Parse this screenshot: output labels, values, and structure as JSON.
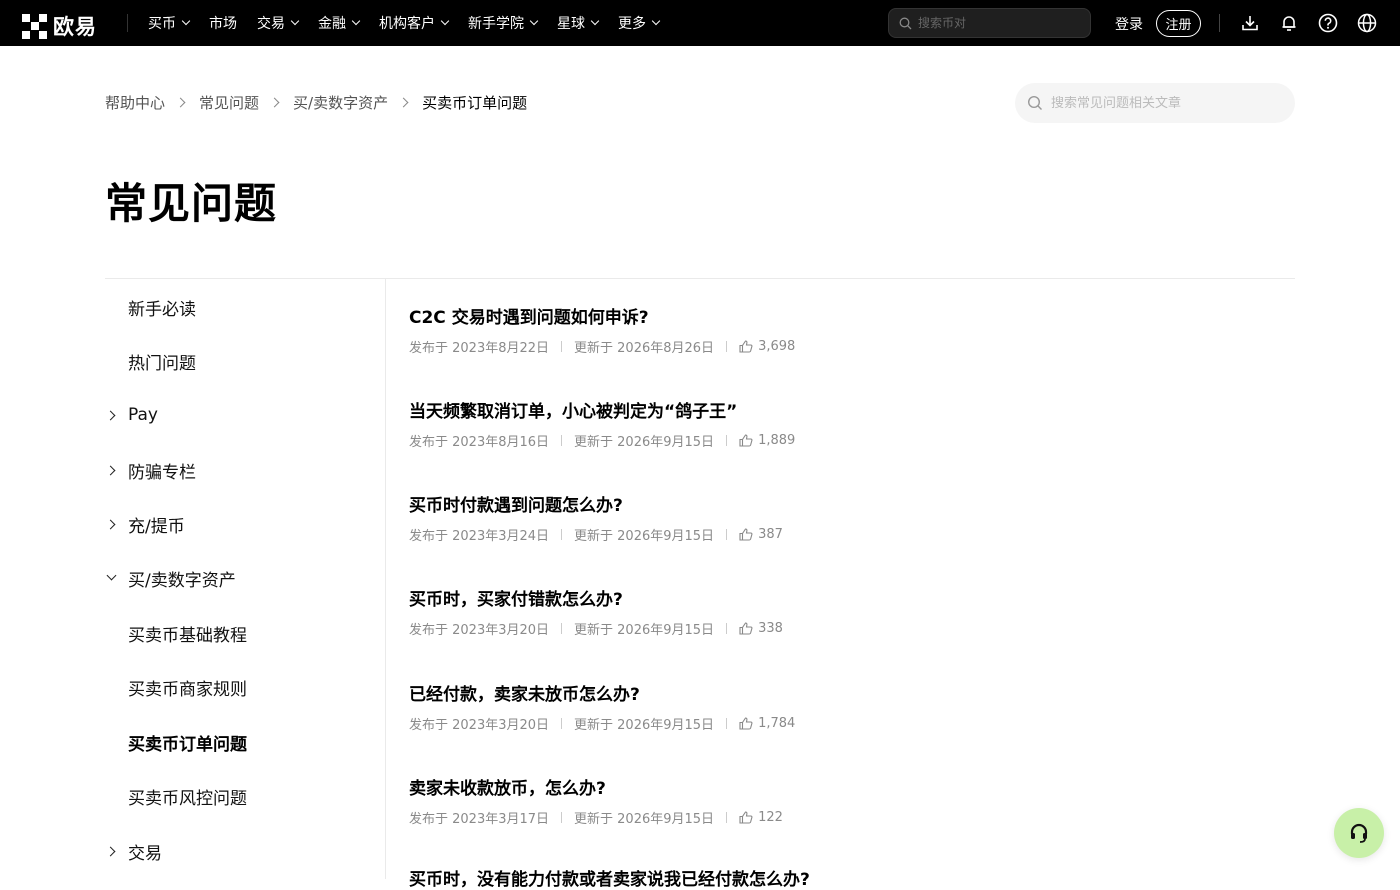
{
  "brand": {
    "name": "欧易"
  },
  "nav": {
    "items": [
      {
        "label": "买币",
        "dropdown": true
      },
      {
        "label": "市场",
        "dropdown": false
      },
      {
        "label": "交易",
        "dropdown": true
      },
      {
        "label": "金融",
        "dropdown": true
      },
      {
        "label": "机构客户",
        "dropdown": true
      },
      {
        "label": "新手学院",
        "dropdown": true
      },
      {
        "label": "星球",
        "dropdown": true
      },
      {
        "label": "更多",
        "dropdown": true
      }
    ],
    "search_placeholder": "搜索币对",
    "login_label": "登录",
    "register_label": "注册"
  },
  "breadcrumb": [
    "帮助中心",
    "常见问题",
    "买/卖数字资产",
    "买卖币订单问题"
  ],
  "help_search_placeholder": "搜索常见问题相关文章",
  "page_title": "常见问题",
  "sidebar": [
    {
      "label": "新手必读",
      "arrow": "none",
      "active": false
    },
    {
      "label": "热门问题",
      "arrow": "none",
      "active": false
    },
    {
      "label": "Pay",
      "arrow": "right",
      "active": false
    },
    {
      "label": "防骗专栏",
      "arrow": "right",
      "active": false
    },
    {
      "label": "充/提币",
      "arrow": "right",
      "active": false
    },
    {
      "label": "买/卖数字资产",
      "arrow": "down",
      "active": false
    },
    {
      "label": "买卖币基础教程",
      "arrow": "none",
      "active": false
    },
    {
      "label": "买卖币商家规则",
      "arrow": "none",
      "active": false
    },
    {
      "label": "买卖币订单问题",
      "arrow": "none",
      "active": true
    },
    {
      "label": "买卖币风控问题",
      "arrow": "none",
      "active": false
    },
    {
      "label": "交易",
      "arrow": "right",
      "active": false
    }
  ],
  "articles": [
    {
      "title": "C2C 交易时遇到问题如何申诉?",
      "published": "发布于 2023年8月22日",
      "updated": "更新于 2026年8月26日",
      "likes": "3,698"
    },
    {
      "title": "当天频繁取消订单，小心被判定为“鸽子王”",
      "published": "发布于 2023年8月16日",
      "updated": "更新于 2026年9月15日",
      "likes": "1,889"
    },
    {
      "title": "买币时付款遇到问题怎么办?",
      "published": "发布于 2023年3月24日",
      "updated": "更新于 2026年9月15日",
      "likes": "387"
    },
    {
      "title": "买币时，买家付错款怎么办?",
      "published": "发布于 2023年3月20日",
      "updated": "更新于 2026年9月15日",
      "likes": "338"
    },
    {
      "title": "已经付款，卖家未放币怎么办?",
      "published": "发布于 2023年3月20日",
      "updated": "更新于 2026年9月15日",
      "likes": "1,784"
    },
    {
      "title": "卖家未收款放币，怎么办?",
      "published": "发布于 2023年3月17日",
      "updated": "更新于 2026年9月15日",
      "likes": "122"
    },
    {
      "title": "买币时，没有能力付款或者卖家说我已经付款怎么办?",
      "published": "",
      "updated": "",
      "likes": ""
    }
  ],
  "colors": {
    "topbar": "#000000",
    "support_bubble": "#c8f0a8"
  }
}
